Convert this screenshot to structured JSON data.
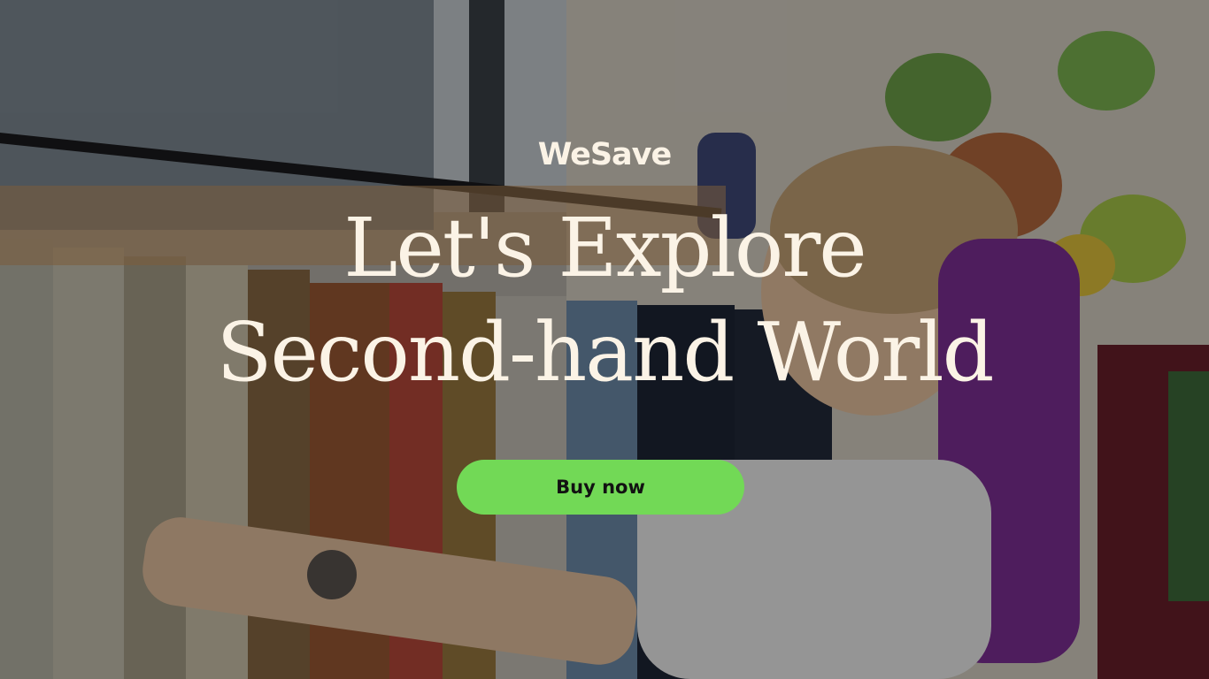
{
  "brand": {
    "name": "WeSave"
  },
  "hero": {
    "headline_line1": "Let's Explore",
    "headline_line2": "Second-hand World",
    "cta_label": "Buy now",
    "background_image": "woman-browsing-clothing-rack-photo"
  },
  "colors": {
    "text_cream": "#fbf3e6",
    "cta_green": "#72d956",
    "cta_text": "#121212"
  }
}
